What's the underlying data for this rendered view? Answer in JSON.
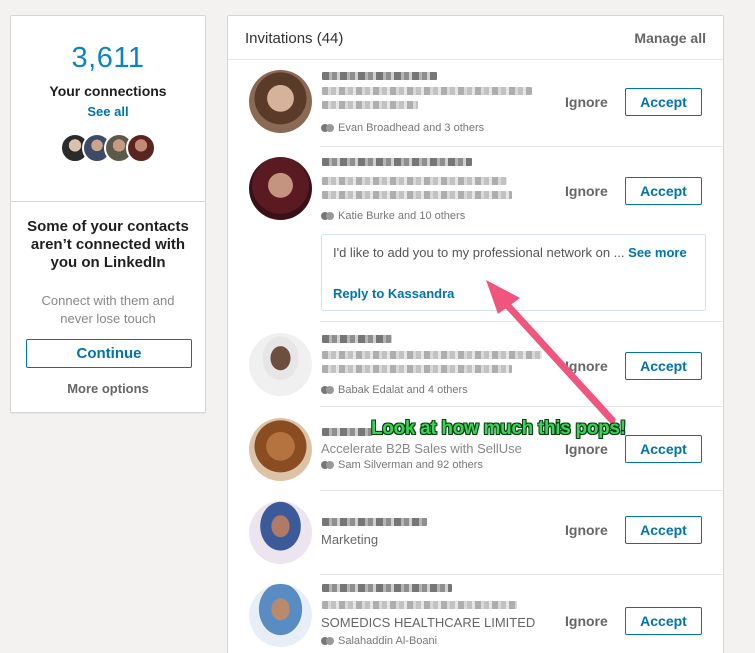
{
  "sidebar": {
    "connections_count": "3,611",
    "connections_label": "Your connections",
    "see_all": "See all",
    "contacts_title": "Some of your contacts aren’t connected with you on LinkedIn",
    "contacts_sub": "Connect with them and never lose touch",
    "continue_label": "Continue",
    "more_options": "More options"
  },
  "invitations": {
    "title": "Invitations (44)",
    "manage_all": "Manage all",
    "ignore_label": "Ignore",
    "accept_label": "Accept",
    "items": [
      {
        "shared": "Evan Broadhead and 3 others",
        "headline": ""
      },
      {
        "shared": "Katie Burke and 10 others",
        "headline": ""
      },
      {
        "shared": "Babak Edalat and 4 others",
        "headline": ""
      },
      {
        "shared": "Sam Silverman and 92 others",
        "headline": "Accelerate B2B Sales with SellUse"
      },
      {
        "shared": "",
        "headline": "Marketing"
      },
      {
        "shared": "Salahaddin Al-Boani",
        "headline": "SOMEDICS HEALTHCARE LIMITED"
      }
    ],
    "message": {
      "text": "I'd like to add you to my professional network on ...",
      "see_more": "See more",
      "reply": "Reply to Kassandra"
    }
  },
  "annotation": {
    "text": "Look at how much this pops!",
    "arrow_color": "#f0557d",
    "text_color": "#39d454"
  },
  "colors": {
    "accent": "#0073b1",
    "count": "#0a86c4"
  }
}
